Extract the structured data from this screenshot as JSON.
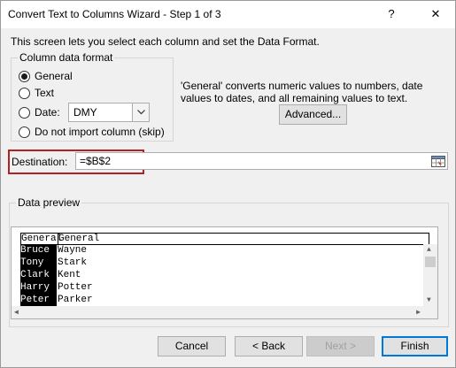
{
  "window": {
    "title": "Convert Text to Columns Wizard - Step 1 of 3",
    "help_label": "?",
    "close_label": "✕"
  },
  "intro": "This screen lets you select each column and set the Data Format.",
  "format_group": {
    "title": "Column data format",
    "options": [
      {
        "label": "General",
        "checked": true
      },
      {
        "label": "Text",
        "checked": false
      },
      {
        "label": "Date:",
        "checked": false
      },
      {
        "label": "Do not import column (skip)",
        "checked": false
      }
    ],
    "date_select_value": "DMY"
  },
  "description": "'General' converts numeric values to numbers, date values to dates, and all remaining values to text.",
  "advanced_label": "Advanced...",
  "destination": {
    "label": "Destination:",
    "value": "=$B$2"
  },
  "preview": {
    "title": "Data preview",
    "headers": [
      "General",
      "General"
    ],
    "rows": [
      [
        "Bruce",
        "Wayne"
      ],
      [
        "Tony",
        "Stark"
      ],
      [
        "Clark",
        "Kent"
      ],
      [
        "Harry",
        "Potter"
      ],
      [
        "Peter",
        "Parker"
      ]
    ]
  },
  "buttons": {
    "cancel": "Cancel",
    "back": "< Back",
    "next": "Next >",
    "finish": "Finish"
  }
}
